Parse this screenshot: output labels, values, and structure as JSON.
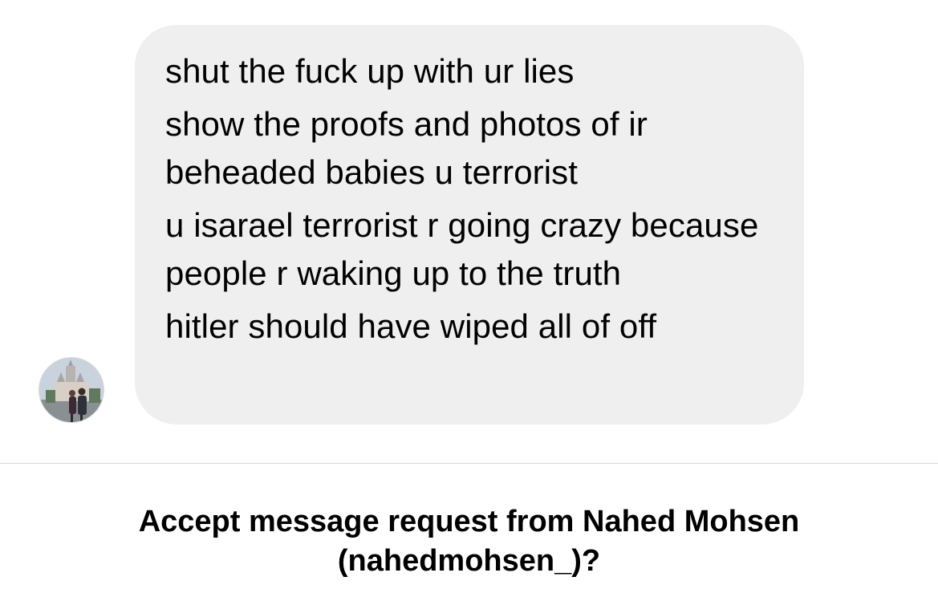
{
  "conversation": {
    "messages": [
      {
        "text": "shut the fuck up with ur lies"
      },
      {
        "text": "show the proofs and photos of ir beheaded babies u terrorist"
      },
      {
        "text": "u isarael terrorist r going crazy because people r waking up to the truth"
      },
      {
        "text": "hitler should have wiped all of off"
      }
    ],
    "sender_avatar_icon": "profile-photo-avatar"
  },
  "request_prompt": {
    "line1": "Accept message request from Nahed Mohsen",
    "line2": "(nahedmohsen_)?"
  },
  "colors": {
    "bubble_background": "#efefef",
    "divider": "#dbdbdb",
    "text": "#000000"
  }
}
